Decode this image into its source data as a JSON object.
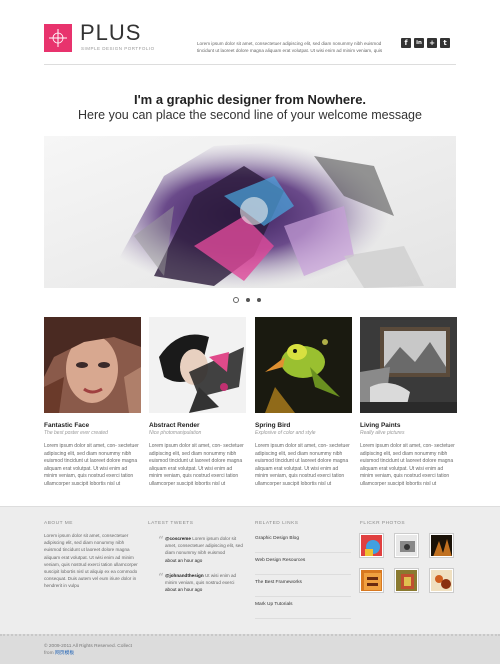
{
  "header": {
    "logo_text": "PLUS",
    "tagline": "SIMPLE DESIGN PORTFOLIO",
    "text": "Lorem ipsum dolor sit amet, consectetuer adipiscing elit, sed diam nonummy nibh euismod tincidunt ut laoreet dolore magna aliquam erat volutpat. Ut wisi enim ad minim veniam, quis",
    "social": [
      {
        "icon": "facebook-icon",
        "glyph": "f"
      },
      {
        "icon": "linkedin-icon",
        "glyph": "in"
      },
      {
        "icon": "plus-icon",
        "glyph": "+"
      },
      {
        "icon": "twitter-icon",
        "glyph": "t"
      }
    ]
  },
  "welcome": {
    "line1": "I'm a graphic designer from Nowhere.",
    "line2": "Here you can place the second line of your welcome message"
  },
  "slider": {
    "slides": 3,
    "active": 1
  },
  "portfolio": [
    {
      "title": "Fantastic Face",
      "subtitle": "The best poster ever created",
      "text": "Lorem ipsum dolor sit amet, con- sectetuer adipiscing elit, sed diam nonummy nibh euismod tincidunt ut laoreet dolore magna aliquam erat volutpat. Ut wisi enim ad minim veniam, quis nostrud exerci tation ullamcorper suscipit lobortis nisl ut"
    },
    {
      "title": "Abstract Render",
      "subtitle": "Nice photomanipulation",
      "text": "Lorem ipsum dolor sit amet, con- sectetuer adipiscing elit, sed diam nonummy nibh euismod tincidunt ut laoreet dolore magna aliquam erat volutpat. Ut wisi enim ad minim veniam, quis nostrud exerci tation ullamcorper suscipit lobortis nisl ut"
    },
    {
      "title": "Spring Bird",
      "subtitle": "Explosive of color and style",
      "text": "Lorem ipsum dolor sit amet, con- sectetuer adipiscing elit, sed diam nonummy nibh euismod tincidunt ut laoreet dolore magna aliquam erat volutpat. Ut wisi enim ad minim veniam, quis nostrud exerci tation ullamcorper suscipit lobortis nisl ut"
    },
    {
      "title": "Living Paints",
      "subtitle": "Really alive pictures",
      "text": "Lorem ipsum dolor sit amet, con- sectetuer adipiscing elit, sed diam nonummy nibh euismod tincidunt ut laoreet dolore magna aliquam erat volutpat. Ut wisi enim ad minim veniam, quis nostrud exerci tation ullamcorper suscipit lobortis nisl ut"
    }
  ],
  "footer": {
    "about": {
      "heading": "ABOUT ME",
      "text": "Lorem ipsum dolor sit amet, consectetuer adipiscing elit, sed diam nonummy nibh euismod tincidunt ut laoreet dolore magna aliquam erat volutpat. Ut wisi enim ad minim veniam, quis nostrud exerci tation ullamcorper suscipit lobortis nisl ut aliquip ex ea commodo consequat. Duis autem vel eum iriure dolor in hendrerit in vulpu"
    },
    "tweets": {
      "heading": "LATEST TWEETS",
      "items": [
        {
          "user": "@coscreme",
          "text": "Lorem ipsum dolor sit amet, consectetuer adipiscing elit, sed diam nonummy nibh euismod",
          "time": "about an hour ago"
        },
        {
          "user": "@johnandthesign",
          "text": "Ut wisi enim ad minim veniam, quis nostrud exerci",
          "time": "about an hour ago"
        }
      ]
    },
    "links": {
      "heading": "RELATED LINKS",
      "items": [
        "Graphic Design Blog",
        "Web Design Resources",
        "The Best Frameworks",
        "Mark Up Tutorials"
      ]
    },
    "flickr": {
      "heading": "FLICKR PHOTOS"
    },
    "copyright": "© 2009-2011 All Rights Reserved. Collect",
    "copyright_from": "from",
    "copyright_link": "网页模板"
  },
  "colors": {
    "accent": "#e8336d",
    "footer_bg": "#ededed"
  }
}
